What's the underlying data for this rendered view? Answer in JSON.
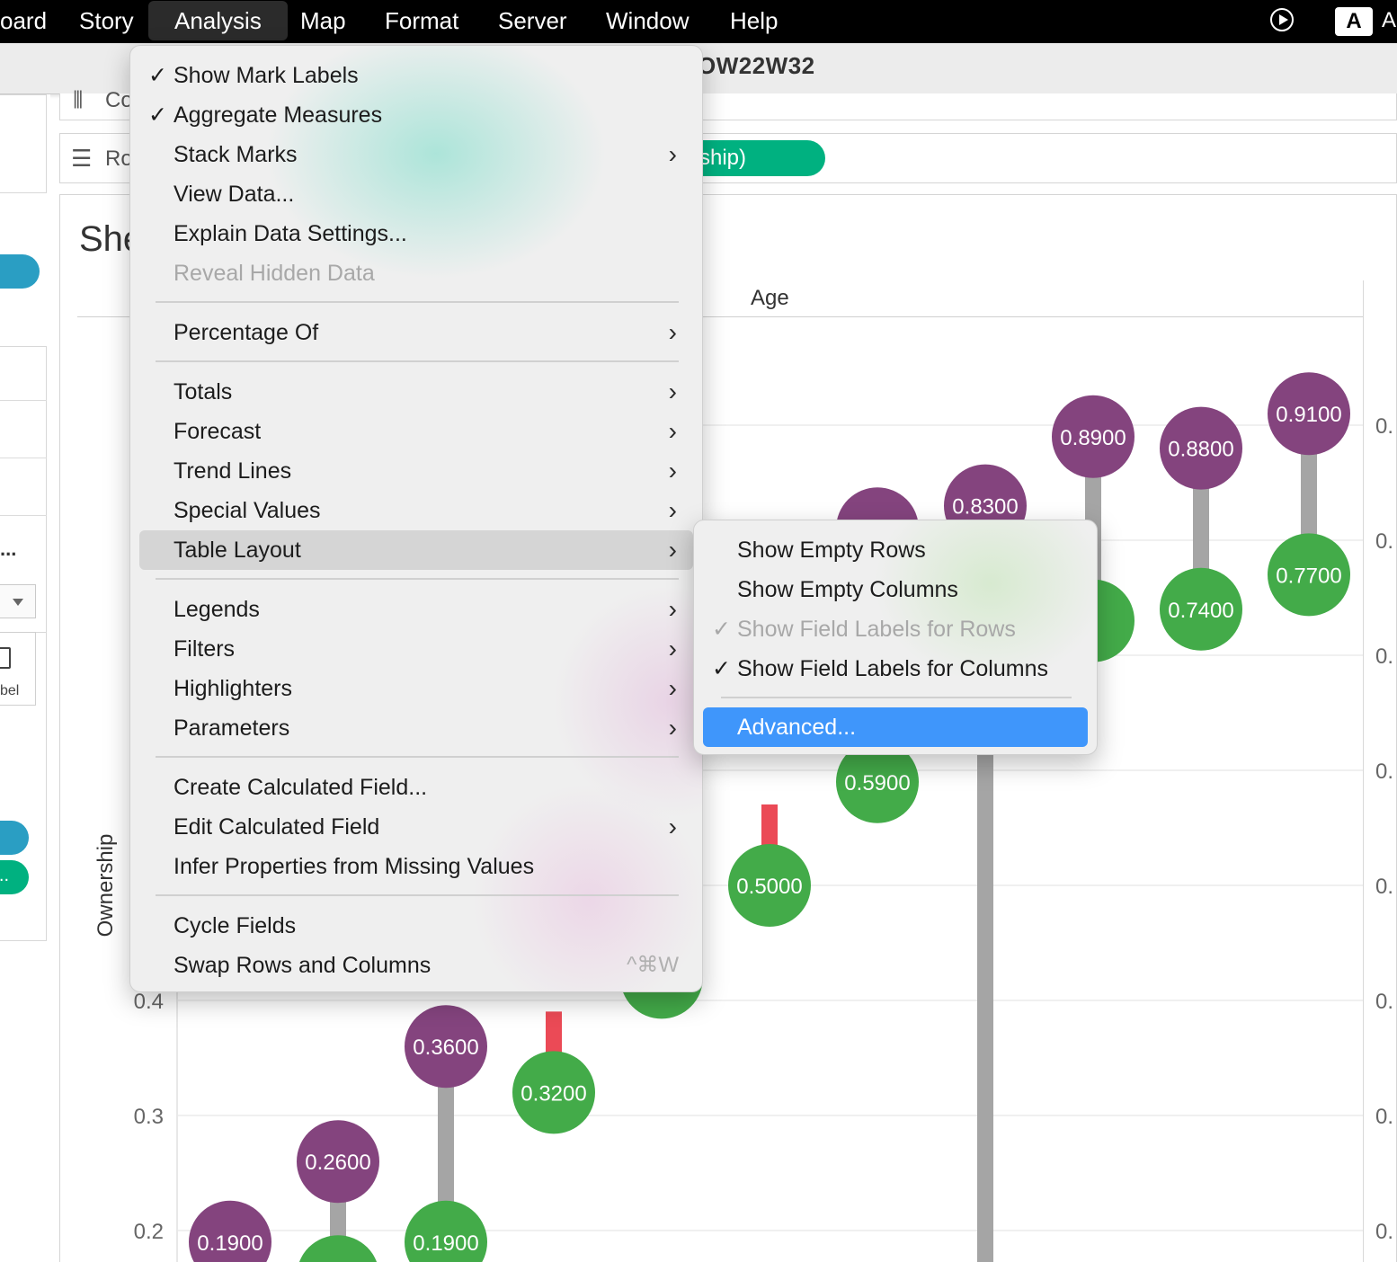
{
  "menubar": {
    "items": [
      "oard",
      "Story",
      "Analysis",
      "Map",
      "Format",
      "Server",
      "Window",
      "Help"
    ],
    "active": "Analysis",
    "right_badge": "A",
    "right_text": "A"
  },
  "toolbar": {
    "title": "OW22W32"
  },
  "shelves": {
    "columns_label": "Co",
    "rows_label": "Ro",
    "rows_pill": "ship)"
  },
  "left_panel": {
    "dots": "...",
    "label_fragment": "bel",
    "pill_fragment": "..."
  },
  "sheet": {
    "title": "She",
    "column_header": "Age",
    "y_axis_title": "Ownership"
  },
  "colors": {
    "purple": "#84447e",
    "green": "#43ab49",
    "connector_gray": "#a5a5a5",
    "connector_red": "#eb4a56",
    "menu_highlight": "#3f96fb",
    "pill_green": "#00b180",
    "pill_blue": "#2a9ec3"
  },
  "analysis_menu": {
    "items": [
      {
        "label": "Show Mark Labels",
        "checked": true
      },
      {
        "label": "Aggregate Measures",
        "checked": true
      },
      {
        "label": "Stack Marks",
        "submenu": true
      },
      {
        "label": "View Data..."
      },
      {
        "label": "Explain Data Settings..."
      },
      {
        "label": "Reveal Hidden Data",
        "disabled": true
      },
      {
        "label": "Percentage Of",
        "submenu": true
      },
      {
        "label": "Totals",
        "submenu": true
      },
      {
        "label": "Forecast",
        "submenu": true
      },
      {
        "label": "Trend Lines",
        "submenu": true
      },
      {
        "label": "Special Values",
        "submenu": true
      },
      {
        "label": "Table Layout",
        "submenu": true,
        "highlighted": true
      },
      {
        "label": "Legends",
        "submenu": true
      },
      {
        "label": "Filters",
        "submenu": true
      },
      {
        "label": "Highlighters",
        "submenu": true
      },
      {
        "label": "Parameters",
        "submenu": true
      },
      {
        "label": "Create Calculated Field..."
      },
      {
        "label": "Edit Calculated Field",
        "submenu": true
      },
      {
        "label": "Infer Properties from Missing Values"
      },
      {
        "label": "Cycle Fields"
      },
      {
        "label": "Swap Rows and Columns",
        "shortcut": "^⌘W"
      }
    ]
  },
  "table_layout_submenu": {
    "items": [
      {
        "label": "Show Empty Rows"
      },
      {
        "label": "Show Empty Columns"
      },
      {
        "label": "Show Field Labels for Rows",
        "checked": true,
        "disabled": true
      },
      {
        "label": "Show Field Labels for Columns",
        "checked": true
      },
      {
        "label": "Advanced...",
        "selected": true
      }
    ]
  },
  "chart_data": {
    "type": "dumbbell",
    "ylabel": "Ownership",
    "column_header": "Age",
    "y_ticks_left": [
      "0.2",
      "0.3",
      "0.4"
    ],
    "y_ticks_right_partial": [
      "0.",
      "0.",
      "0.",
      "0.",
      "0.",
      "0.",
      "0.",
      "0."
    ],
    "pairs": [
      {
        "purple": 0.19,
        "purple_label": "0.1900",
        "green": null,
        "green_label": "",
        "connector": "gray"
      },
      {
        "purple": 0.26,
        "purple_label": "0.2600",
        "green": 0.16,
        "green_label": "",
        "connector": "gray"
      },
      {
        "purple": 0.36,
        "purple_label": "0.3600",
        "green": 0.19,
        "green_label": "0.1900",
        "connector": "gray"
      },
      {
        "purple": null,
        "purple_label": "",
        "green": 0.32,
        "green_label": "0.3200",
        "connector": "red"
      },
      {
        "purple": null,
        "purple_label": "",
        "green": 0.42,
        "green_label": "",
        "connector": "gray"
      },
      {
        "purple": null,
        "purple_label": "",
        "green": 0.5,
        "green_label": "0.5000",
        "connector": "red"
      },
      {
        "purple": 0.81,
        "purple_label": "",
        "green": 0.59,
        "green_label": "0.5900",
        "connector": "gray"
      },
      {
        "purple": 0.83,
        "purple_label": "0.8300",
        "green": null,
        "green_label": "",
        "connector": "gray"
      },
      {
        "purple": 0.89,
        "purple_label": "0.8900",
        "green": 0.73,
        "green_label": "",
        "connector": "gray"
      },
      {
        "purple": 0.88,
        "purple_label": "0.8800",
        "green": 0.74,
        "green_label": "0.7400",
        "connector": "gray"
      },
      {
        "purple": 0.91,
        "purple_label": "0.9100",
        "green": 0.77,
        "green_label": "0.7700",
        "connector": "gray"
      }
    ]
  }
}
